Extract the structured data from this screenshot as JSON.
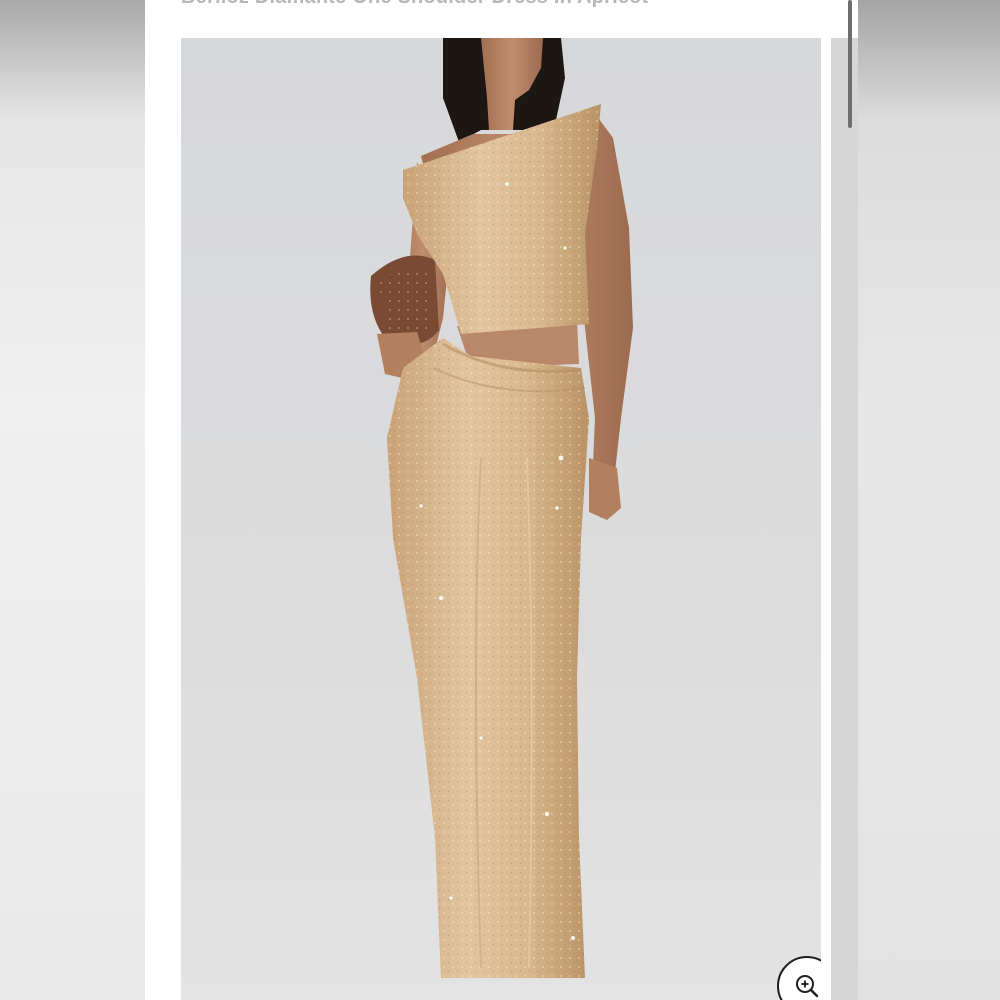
{
  "product": {
    "title": "Berlioz Diamante One Shoulder Dress in Apricot"
  },
  "image": {
    "subject": "model-wearing-dress"
  },
  "controls": {
    "zoom_icon": "zoom-in-icon"
  },
  "colors": {
    "dress": "#d9b98d",
    "background": "#dcdcdc",
    "clutch": "#7a4a34"
  }
}
